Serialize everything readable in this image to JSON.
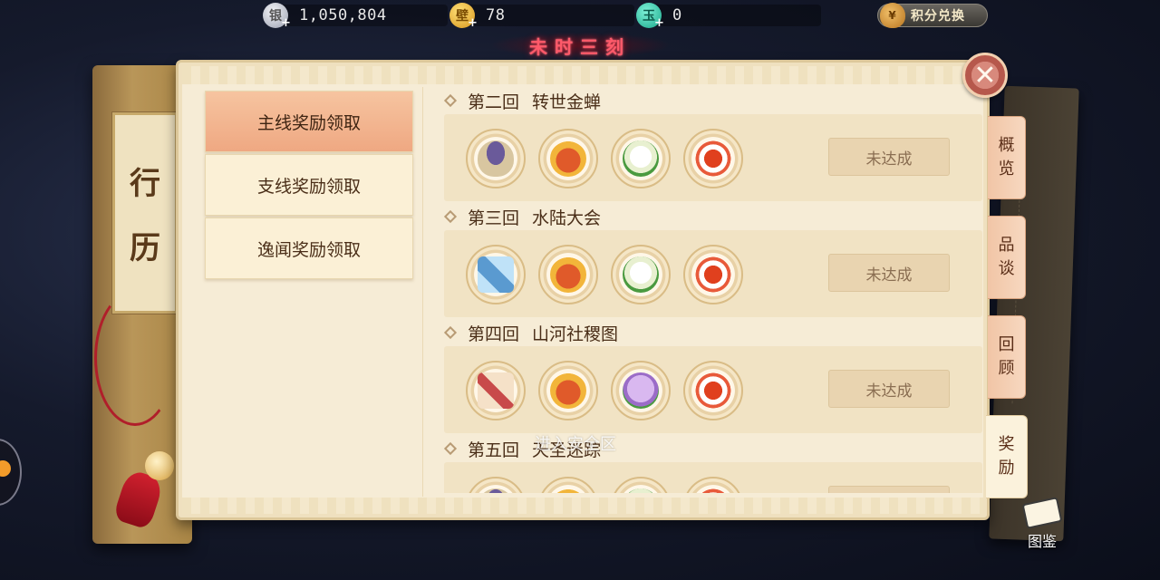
{
  "currencies": [
    {
      "icon": "silver-coin-icon",
      "glyph": "银",
      "value": "1,050,804"
    },
    {
      "icon": "gold-coin-icon",
      "glyph": "壁",
      "value": "78"
    },
    {
      "icon": "jade-coin-icon",
      "glyph": "玉",
      "value": "0"
    }
  ],
  "exchange_label": "积分兑换",
  "time_label": "未时三刻",
  "book_title": [
    "行",
    "历"
  ],
  "nav": [
    {
      "label": "主线奖励领取",
      "active": true
    },
    {
      "label": "支线奖励领取",
      "active": false
    },
    {
      "label": "逸闻奖励领取",
      "active": false
    }
  ],
  "chapters": [
    {
      "num": "第二回",
      "title": "转世金蝉",
      "items": [
        "bowl",
        "pouch",
        "lily",
        "dish"
      ],
      "status": "未达成"
    },
    {
      "num": "第三回",
      "title": "水陆大会",
      "items": [
        "scroll-blue",
        "pouch",
        "lily",
        "dish"
      ],
      "status": "未达成"
    },
    {
      "num": "第四回",
      "title": "山河社稷图",
      "items": [
        "scroll-red",
        "pouch",
        "hydrangea",
        "dish"
      ],
      "status": "未达成"
    },
    {
      "num": "第五回",
      "title": "天圣迷踪",
      "items": [
        "bowl",
        "pouch",
        "lily",
        "dish"
      ],
      "status": ""
    }
  ],
  "watermark": "进入安全区",
  "tabs": [
    {
      "label": [
        "概",
        "览"
      ],
      "active": false
    },
    {
      "label": [
        "品",
        "谈"
      ],
      "active": false
    },
    {
      "label": [
        "回",
        "顾"
      ],
      "active": false
    },
    {
      "label": [
        "奖",
        "励"
      ],
      "active": true
    }
  ],
  "close_glyph": "✕",
  "atlas_label": "图鉴"
}
